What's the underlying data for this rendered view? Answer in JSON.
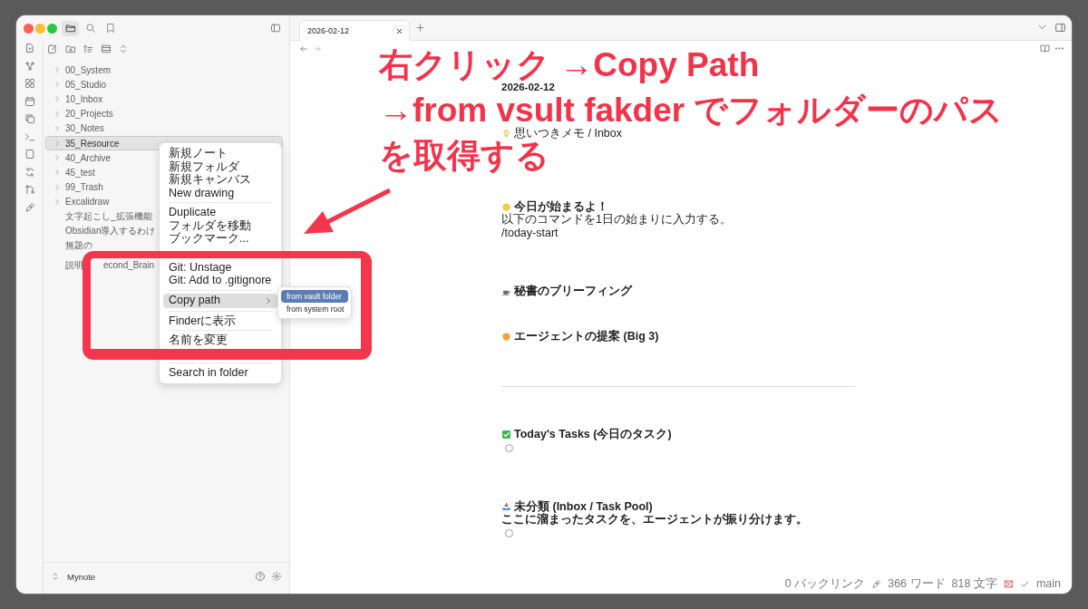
{
  "sidebar_tabs": [
    {
      "kind": "folder",
      "selected": true
    },
    {
      "kind": "search",
      "selected": false
    },
    {
      "kind": "bookmark",
      "selected": false
    }
  ],
  "file_tree": [
    {
      "kind": "folder",
      "label": "00_System",
      "selected": false
    },
    {
      "kind": "folder",
      "label": "05_Studio",
      "selected": false
    },
    {
      "kind": "folder",
      "label": "10_Inbox",
      "selected": false
    },
    {
      "kind": "folder",
      "label": "20_Projects",
      "selected": false
    },
    {
      "kind": "folder",
      "label": "30_Notes",
      "selected": false
    },
    {
      "kind": "folder",
      "label": "35_Resource",
      "selected": true
    },
    {
      "kind": "folder",
      "label": "40_Archive",
      "selected": false
    },
    {
      "kind": "folder",
      "label": "45_test",
      "selected": false
    },
    {
      "kind": "folder",
      "label": "99_Trash",
      "selected": false
    },
    {
      "kind": "folder",
      "label": "Excalidraw",
      "selected": false
    },
    {
      "kind": "note",
      "label": "文字起こし_拡張機能",
      "selected": false
    },
    {
      "kind": "note",
      "label": "Obsidian導入するわけ",
      "selected": false
    },
    {
      "kind": "note",
      "label": "無題の",
      "selected": false
    },
    {
      "kind": "note",
      "label": "説明",
      "tail": "econd_Brain",
      "selected": false
    }
  ],
  "vault": {
    "name": "Mynote"
  },
  "context_menu": {
    "items": [
      {
        "kind": "item",
        "label": "新規ノート"
      },
      {
        "kind": "item",
        "label": "新規フォルダ"
      },
      {
        "kind": "item",
        "label": "新規キャンバス"
      },
      {
        "kind": "item",
        "label": "New drawing"
      },
      {
        "kind": "separator"
      },
      {
        "kind": "item",
        "label": "Duplicate"
      },
      {
        "kind": "item",
        "label": "フォルダを移動"
      },
      {
        "kind": "item",
        "label": "ブックマーク..."
      },
      {
        "kind": "item",
        "label": "Git: Unstage"
      },
      {
        "kind": "item",
        "label": "Git: Add to .gitignore"
      },
      {
        "kind": "separator"
      },
      {
        "kind": "submenu",
        "label": "Copy path",
        "selected": true
      },
      {
        "kind": "separator"
      },
      {
        "kind": "item",
        "label": "Finderに表示"
      },
      {
        "kind": "separator"
      },
      {
        "kind": "item",
        "label": "名前を変更"
      },
      {
        "kind": "separator"
      },
      {
        "kind": "item",
        "label": "Search in folder"
      }
    ],
    "submenu": [
      {
        "label": "from vault folder",
        "selected": true
      },
      {
        "label": "from system root",
        "selected": false
      }
    ]
  },
  "tabs": [
    {
      "label": "2026-02-12",
      "selected": true
    }
  ],
  "editor": {
    "blocks": [
      {
        "kind": "title",
        "text": "2026-02-12"
      },
      {
        "kind": "text",
        "text": "思いつきメモ / Inbox"
      },
      {
        "kind": "heading",
        "text": "今日が始まるよ！"
      },
      {
        "kind": "text",
        "text": "以下のコマンドを1日の始まりに入力する。"
      },
      {
        "kind": "text",
        "text": "/today-start"
      },
      {
        "kind": "heading",
        "text": "秘書のブリーフィング"
      },
      {
        "kind": "heading",
        "text": "エージェントの提案 (Big 3)"
      },
      {
        "kind": "rule"
      },
      {
        "kind": "heading",
        "text": "Today's Tasks (今日のタスク)"
      },
      {
        "kind": "task",
        "checked": false
      },
      {
        "kind": "heading",
        "text": "未分類 (Inbox / Task Pool)"
      },
      {
        "kind": "heading",
        "text": "ここに溜まったタスクを、エージェントが振り分けます。"
      },
      {
        "kind": "task",
        "checked": false
      }
    ]
  },
  "status_bar": {
    "backlinks": "0 バックリンク",
    "words": "366 ワード",
    "chars": "818 文字",
    "branch": "main"
  },
  "annotation": {
    "lines": [
      "右クリック →Copy Path",
      "→from vsult fakder でフォルダーのパス",
      "を取得する"
    ]
  }
}
